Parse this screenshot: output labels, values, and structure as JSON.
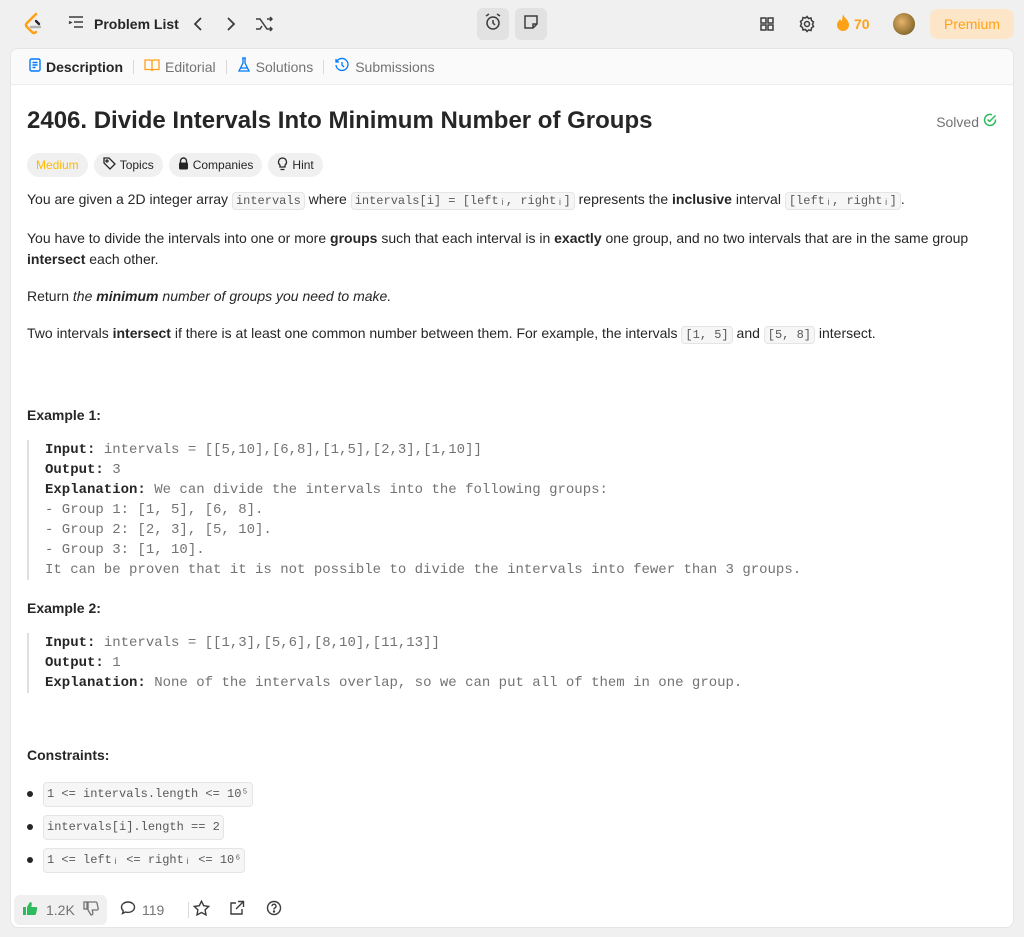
{
  "topbar": {
    "problem_list": "Problem List",
    "streak": "70",
    "premium": "Premium"
  },
  "tabs": [
    {
      "label": "Description"
    },
    {
      "label": "Editorial"
    },
    {
      "label": "Solutions"
    },
    {
      "label": "Submissions"
    }
  ],
  "problem": {
    "title": "2406. Divide Intervals Into Minimum Number of Groups",
    "status": "Solved",
    "tags": {
      "difficulty": "Medium",
      "topics": "Topics",
      "companies": "Companies",
      "hint": "Hint"
    }
  },
  "desc": {
    "p1_a": "You are given a 2D integer array ",
    "p1_code1": "intervals",
    "p1_b": " where ",
    "p1_code2": "intervals[i] = [leftᵢ, rightᵢ]",
    "p1_c": " represents the ",
    "p1_bold": "inclusive",
    "p1_d": " interval ",
    "p1_code3": "[leftᵢ, rightᵢ]",
    "p1_e": ".",
    "p2_a": "You have to divide the intervals into one or more ",
    "p2_b1": "groups",
    "p2_b": " such that each interval is in ",
    "p2_b2": "exactly",
    "p2_c": " one group, and no two intervals that are in the same group ",
    "p2_b3": "intersect",
    "p2_d": " each other.",
    "p3_a": "Return ",
    "p3_b": "the ",
    "p3_bold": "minimum",
    "p3_c": " number of groups you need to make.",
    "p4_a": "Two intervals ",
    "p4_bold": "intersect",
    "p4_b": " if there is at least one common number between them. For example, the intervals ",
    "p4_code1": "[1, 5]",
    "p4_c": " and ",
    "p4_code2": "[5, 8]",
    "p4_d": " intersect."
  },
  "example1": {
    "heading": "Example 1:",
    "input_label": "Input:",
    "input": " intervals = [[5,10],[6,8],[1,5],[2,3],[1,10]]",
    "output_label": "Output:",
    "output": " 3",
    "expl_label": "Explanation:",
    "expl": " We can divide the intervals into the following groups:",
    "lines": [
      "- Group 1: [1, 5], [6, 8].",
      "- Group 2: [2, 3], [5, 10].",
      "- Group 3: [1, 10].",
      "It can be proven that it is not possible to divide the intervals into fewer than 3 groups."
    ]
  },
  "example2": {
    "heading": "Example 2:",
    "input_label": "Input:",
    "input": " intervals = [[1,3],[5,6],[8,10],[11,13]]",
    "output_label": "Output:",
    "output": " 1",
    "expl_label": "Explanation:",
    "expl": " None of the intervals overlap, so we can put all of them in one group."
  },
  "constraints": {
    "heading": "Constraints:",
    "c1": "1 <= intervals.length <= 10⁵",
    "c2": "intervals[i].length == 2",
    "c3": "1 <= leftᵢ <= rightᵢ <= 10⁶"
  },
  "bottom": {
    "likes": "1.2K",
    "comments": "119"
  }
}
